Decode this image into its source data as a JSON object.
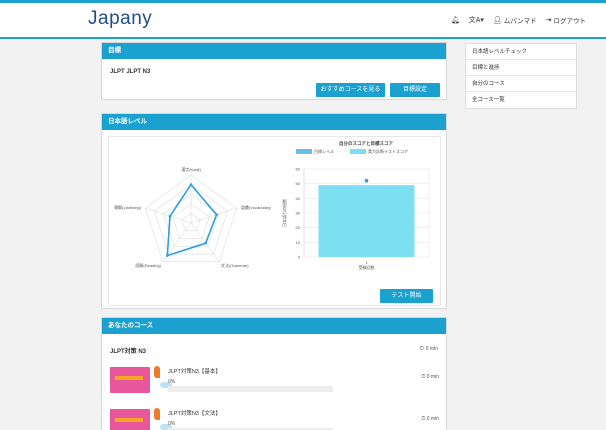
{
  "header": {
    "logo": "Japany",
    "nav": [
      {
        "label": "",
        "icon": "bell-icon"
      },
      {
        "label": "",
        "icon": "language-icon"
      },
      {
        "label": "ムパンマド",
        "icon": "user-icon"
      },
      {
        "label": "ログアウト",
        "icon": "logout-icon"
      }
    ]
  },
  "goal": {
    "header": "目標",
    "text": "JLPT JLPT N3",
    "recommend_button": "おすすめコースを見る",
    "goal_button": "目標設定"
  },
  "level": {
    "header": "日本語レベル",
    "radar": {
      "axes": [
        "語彙(Vocabulary)",
        "文法(Grammar)",
        "読解(Reading)",
        "聴解(Listening)",
        "漢字(Kanji)"
      ],
      "scale_max": 5,
      "values": [
        2.8,
        2.6,
        4.2,
        2.3,
        4.0
      ],
      "color": "#2d9fe0"
    },
    "test_button": "テスト開始"
  },
  "chart_data": {
    "type": "bar",
    "title": "自分のスコアと目標スコア",
    "legend": [
      "目標レベル",
      "実力診断テストスコア"
    ],
    "legend_placement": "top",
    "categories": [
      "1"
    ],
    "x_sublabel": "受験回数",
    "series": [
      {
        "name": "目標レベル",
        "type": "scatter",
        "values": [
          52
        ],
        "color": "#2d9fe0"
      },
      {
        "name": "実力診断テストスコア",
        "type": "bar",
        "values": [
          49
        ],
        "color": "#7de0f2"
      }
    ],
    "ylabel": "日本語力の指数",
    "ylim": [
      0,
      60
    ],
    "yticks": [
      0,
      10,
      20,
      30,
      40,
      50,
      60
    ],
    "grid": true
  },
  "courses": {
    "header": "あなたのコース",
    "title": "JLPT対策 N3",
    "title_time": "0 min",
    "items": [
      {
        "name": "JLPT対策N3【基本】",
        "progress_label": "0%",
        "time": "0 min"
      },
      {
        "name": "JLPT対策N3【文法】",
        "progress_label": "0%",
        "time": "0 min"
      }
    ]
  },
  "sidebar": {
    "items": [
      "日本語レベルチェック",
      "目標と進捗",
      "自分のコース",
      "全コース一覧"
    ]
  },
  "colors": {
    "accent": "#1ba1cf",
    "bar": "#7de0f2",
    "line": "#2d9fe0"
  }
}
